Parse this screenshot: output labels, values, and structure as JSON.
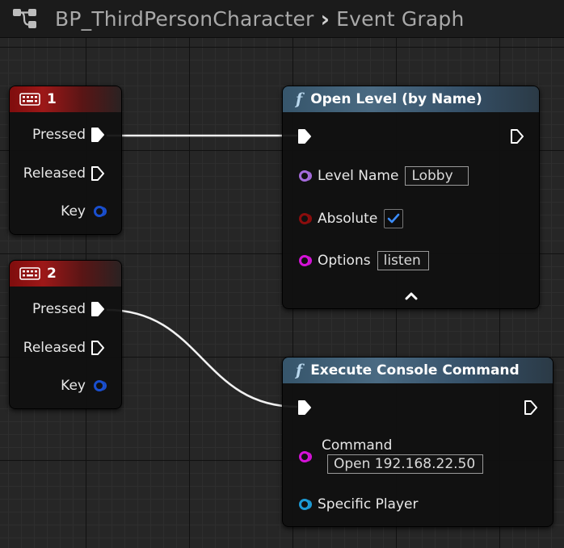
{
  "breadcrumb": {
    "blueprint": "BP_ThirdPersonCharacter",
    "graph": "Event Graph"
  },
  "event_nodes": [
    {
      "key": "1",
      "pins": {
        "pressed": "Pressed",
        "released": "Released",
        "key": "Key"
      }
    },
    {
      "key": "2",
      "pins": {
        "pressed": "Pressed",
        "released": "Released",
        "key": "Key"
      }
    }
  ],
  "open_level": {
    "title": "Open Level (by Name)",
    "level_name_label": "Level Name",
    "level_name_value": "Lobby",
    "absolute_label": "Absolute",
    "absolute_checked": true,
    "options_label": "Options",
    "options_value": "listen"
  },
  "console_command": {
    "title": "Execute Console Command",
    "command_label": "Command",
    "command_value": "Open 192.168.22.50",
    "specific_player_label": "Specific Player"
  },
  "colors": {
    "event_header": "#9d1818",
    "function_header": "#4a6a82",
    "string_pin": "#d512d8",
    "name_pin": "#a56bdc",
    "bool_pin": "#8c0d0d",
    "struct_pin": "#1a4fcf",
    "object_pin": "#1d9bd6",
    "exec_pin": "#ffffff",
    "checkmark": "#3c8dff"
  },
  "icons": [
    "blueprint-graph-icon",
    "keyboard-icon",
    "function-icon",
    "exec-pin-icon",
    "chevron-up-icon"
  ]
}
